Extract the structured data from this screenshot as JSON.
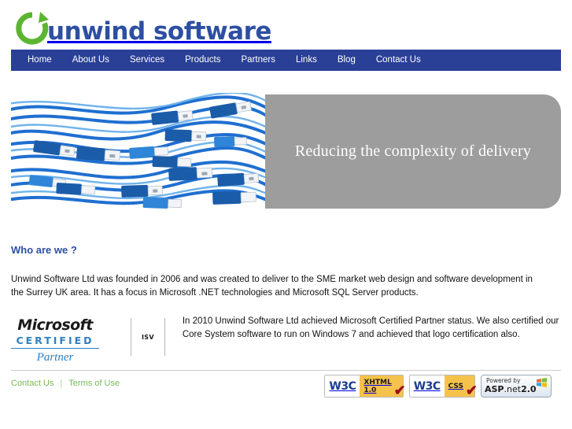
{
  "site": {
    "logo_text": "unwind software",
    "logo_icon": "circular-arrow-icon"
  },
  "nav": {
    "items": [
      {
        "label": "Home"
      },
      {
        "label": "About Us"
      },
      {
        "label": "Services"
      },
      {
        "label": "Products"
      },
      {
        "label": "Partners"
      },
      {
        "label": "Links"
      },
      {
        "label": "Blog"
      },
      {
        "label": "Contact Us"
      }
    ]
  },
  "banner": {
    "tagline": "Reducing the complexity of delivery",
    "image_alt": "tangled blue usb cables",
    "panel_color": "#9d9d9d"
  },
  "main": {
    "heading": "Who are we ?",
    "intro": "Unwind Software Ltd was founded in 2006 and was created to deliver to the SME market web design and software development in the Surrey UK area. It has a focus in Microsoft .NET technologies and Microsoft SQL Server products.",
    "certification": {
      "badge": {
        "brand": "Microsoft",
        "level": "CERTIFIED",
        "program": "Partner",
        "competency": "ISV"
      },
      "text": "In 2010 Unwind Software Ltd achieved Microsoft Certified Partner status. We also certified our Core System software to run on Windows 7 and achieved that logo certification also."
    }
  },
  "footer": {
    "links": [
      {
        "label": "Contact Us"
      },
      {
        "label": "Terms of Use"
      }
    ],
    "separator": "|",
    "badges": [
      {
        "name": "w3c-xhtml-badge",
        "logo": "W3C",
        "line1": "XHTML",
        "line2": "1.0",
        "check": "✔"
      },
      {
        "name": "w3c-css-badge",
        "logo": "W3C",
        "line1": "CSS",
        "line2": "",
        "check": "✔"
      },
      {
        "name": "aspnet-badge",
        "powered": "Powered by",
        "asp": "ASP",
        "net": ".net",
        "version": "2.0"
      }
    ]
  },
  "colors": {
    "nav_blue": "#2a3f96",
    "logo_blue": "#2d4fa2",
    "logo_green": "#5cb531",
    "heading_blue": "#2d4fa2",
    "footer_green": "#77bb55",
    "badge_yellow": "#f5c24c"
  }
}
